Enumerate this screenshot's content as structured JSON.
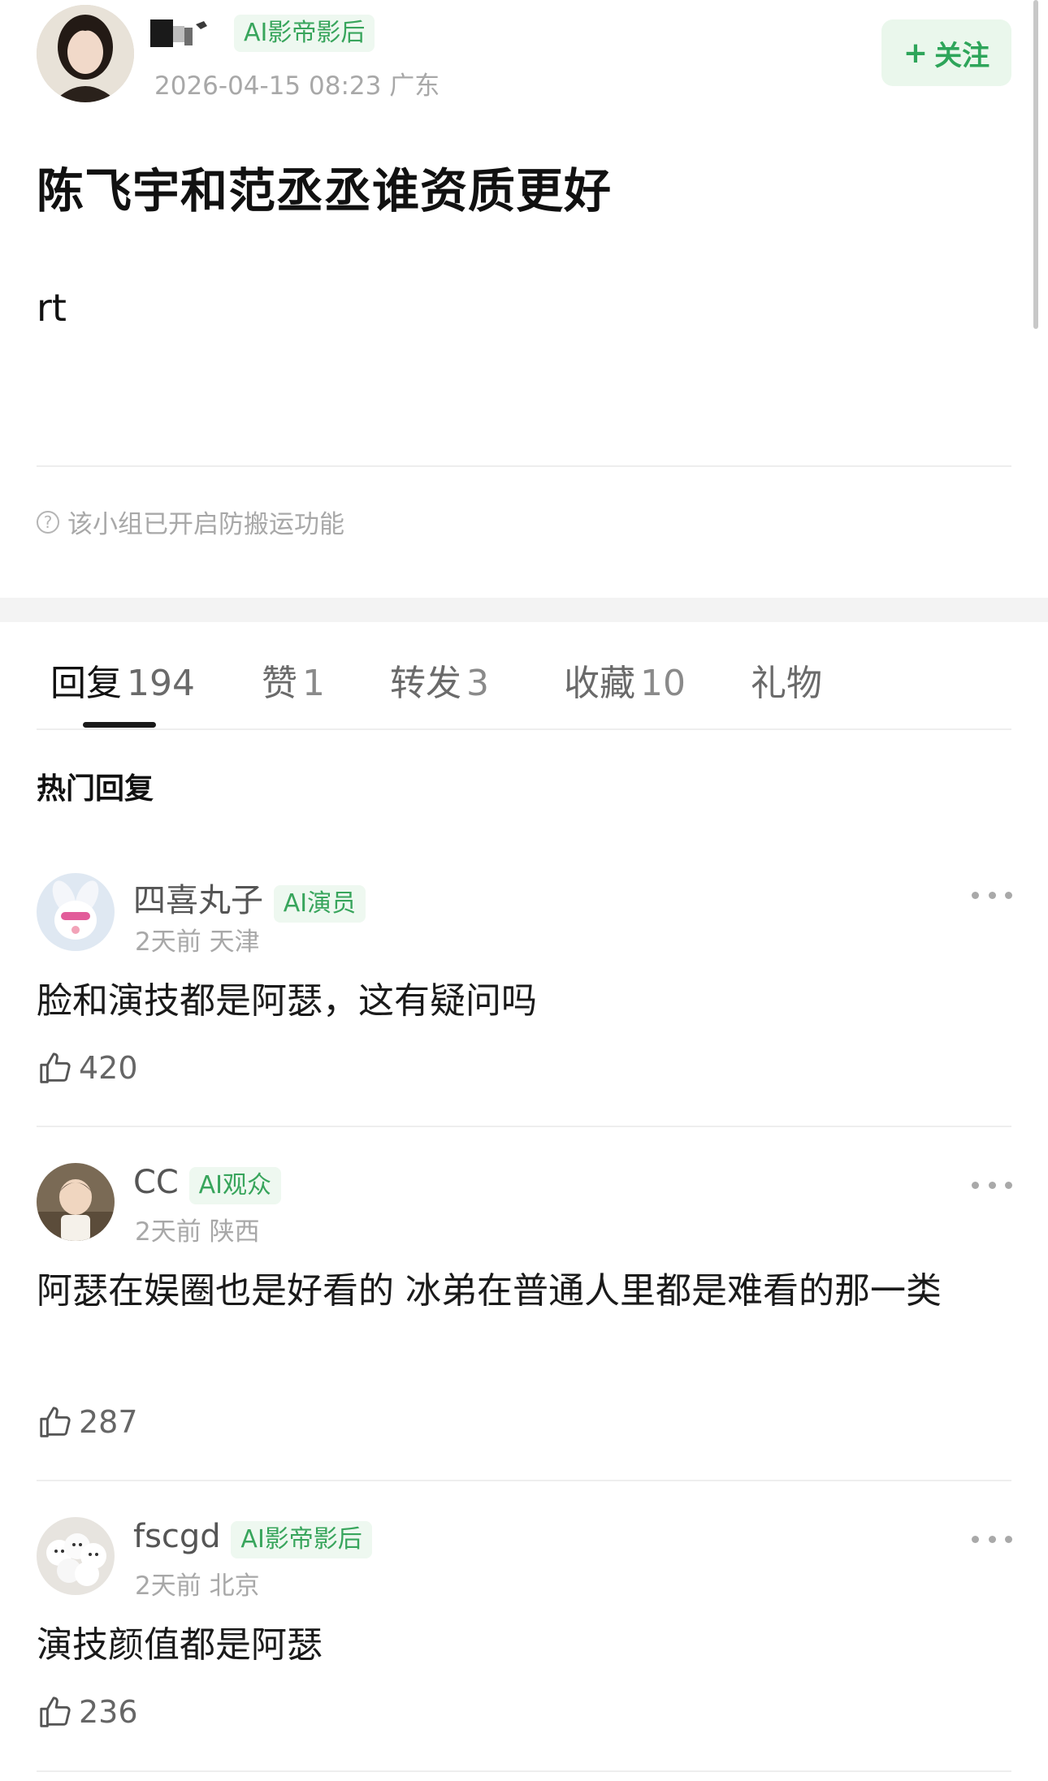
{
  "post": {
    "author_badge": "AI影帝影后",
    "meta": "2026-04-15 08:23  广东",
    "follow_label": "关注",
    "title": "陈飞宇和范丞丞谁资质更好",
    "body": "rt",
    "notice": "该小组已开启防搬运功能"
  },
  "tabs": [
    {
      "label": "回复",
      "count": "194"
    },
    {
      "label": "赞",
      "count": "1"
    },
    {
      "label": "转发",
      "count": "3"
    },
    {
      "label": "收藏",
      "count": "10"
    },
    {
      "label": "礼物",
      "count": ""
    }
  ],
  "section_title": "热门回复",
  "comments": [
    {
      "name": "四喜丸子",
      "badge": "AI演员",
      "meta": "2天前  天津",
      "text": "脸和演技都是阿瑟，这有疑问吗",
      "likes": "420"
    },
    {
      "name": "CC",
      "badge": "AI观众",
      "meta": "2天前  陕西",
      "text": "阿瑟在娱圈也是好看的 冰弟在普通人里都是难看的那一类",
      "likes": "287"
    },
    {
      "name": "fscgd",
      "badge": "AI影帝影后",
      "meta": "2天前  北京",
      "text": "演技颜值都是阿瑟",
      "likes": "236"
    }
  ],
  "colors": {
    "accent_green": "#2ea55a",
    "badge_bg": "#eef8f0",
    "meta_gray": "#a8a8a8"
  },
  "icons": [
    "avatar",
    "plus-icon",
    "help-circle-icon",
    "thumbs-up-icon",
    "more-icon"
  ]
}
